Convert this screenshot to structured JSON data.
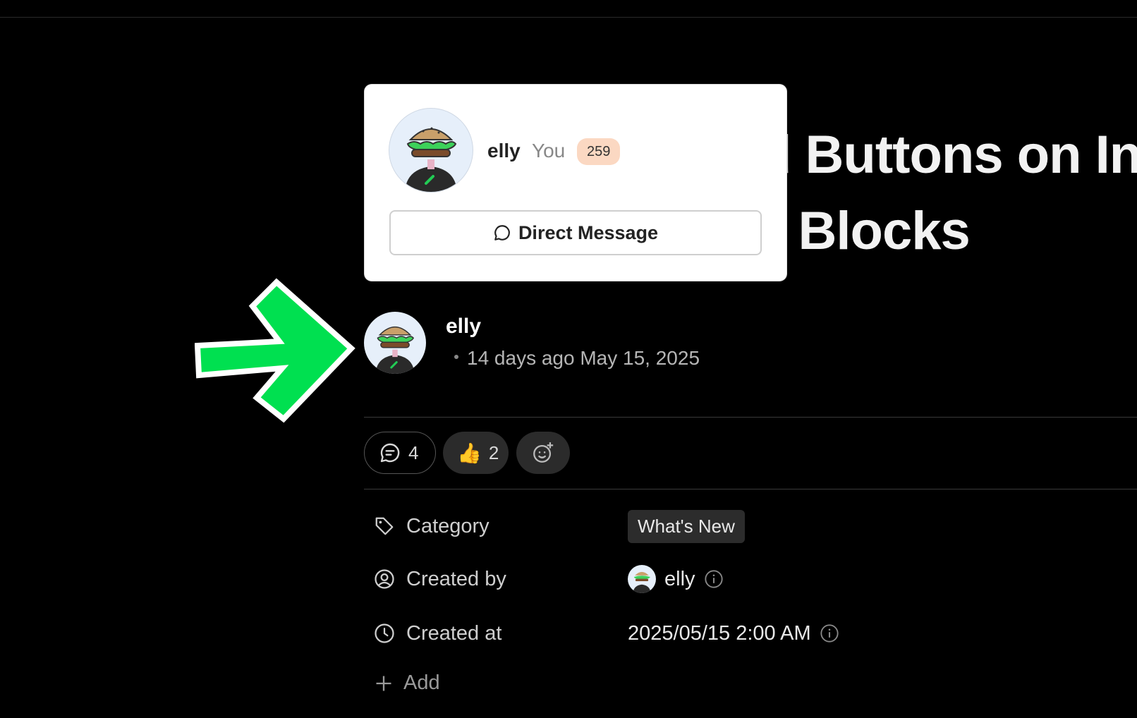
{
  "title": {
    "line1": "d Buttons on In",
    "line2": "d Blocks"
  },
  "popover": {
    "name": "elly",
    "you_label": "You",
    "badge": "259",
    "dm_button_label": "Direct Message"
  },
  "author": {
    "name": "elly",
    "relative_time": "14 days ago",
    "date": "May 15, 2025"
  },
  "reactions": {
    "comment_count": "4",
    "like_emoji": "👍",
    "like_count": "2"
  },
  "properties": {
    "category_label": "Category",
    "category_value": "What's New",
    "created_by_label": "Created by",
    "created_by_value": "elly",
    "created_at_label": "Created at",
    "created_at_value": "2025/05/15 2:00 AM",
    "add_label": "Add"
  },
  "colors": {
    "background": "#000000",
    "popover_bg": "#ffffff",
    "badge_bg": "#fbd8c2",
    "arrow_green": "#00e050"
  }
}
